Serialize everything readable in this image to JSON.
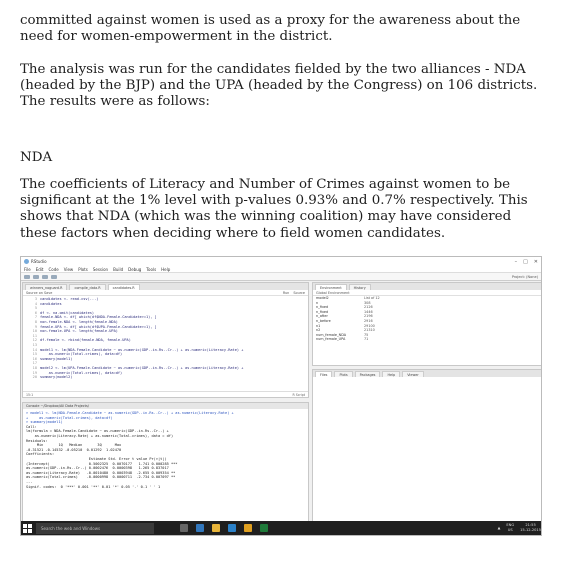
{
  "article": {
    "p1": "committed against women is used as a proxy for the awareness about the need for women-empowerment in the district.",
    "p2": "The analysis was run for the candidates fielded by the two alliances - NDA (headed by the BJP) and the UPA (headed by the Congress) on 106 districts. The results were as follows:",
    "heading": "NDA",
    "p3": "The coefficients of Literacy and Number of Crimes against women to be significant at the 1% level with p-values 0.93% and 0.7% respectively. This shows that NDA (which was the winning coalition) may have considered these factors when deciding where to field women candidates."
  },
  "rstudio": {
    "title": "RStudio",
    "menu": [
      "File",
      "Edit",
      "Code",
      "View",
      "Plots",
      "Session",
      "Build",
      "Debug",
      "Tools",
      "Help"
    ],
    "project": "Project: (None)",
    "editor_tabs": [
      "winners_noguard.R",
      "compile_data.R",
      "candidates.R"
    ],
    "editor_tool": "Source on Save",
    "run_label": "Run",
    "source_label": "Source",
    "code_lines": [
      [
        "3",
        "candidates <- read.csv(...)"
      ],
      [
        "4",
        "candidates"
      ],
      [
        "5",
        ""
      ],
      [
        "6",
        "df <- na.omit(candidates)"
      ],
      [
        "7",
        "female.NDA <- df[ which(df$NDA.Female.Candidate>=1), ]"
      ],
      [
        "8",
        "non.female.NDA <- length(female.NDA)"
      ],
      [
        "9",
        "female.UPA <- df[ which(df$UPA.Female.Candidate>=1), ]"
      ],
      [
        "10",
        "non.female.UPA <- length(female.UPA)"
      ],
      [
        "11",
        ""
      ],
      [
        "12",
        "df.female <- rbind(female.NDA, female.UPA)"
      ],
      [
        "13",
        ""
      ],
      [
        "14",
        "model1 <- lm(NDA.Female.Candidate ~ as.numeric(GDP..in.Rs..Cr..) + as.numeric(Literacy.Rate) +"
      ],
      [
        "15",
        "    as.numeric(Total.crimes), data=df)"
      ],
      [
        "16",
        "summary(model1)"
      ],
      [
        "17",
        ""
      ],
      [
        "18",
        "model2 <- lm(UPA.Female.Candidate ~ as.numeric(GDP..in.Rs..Cr..) + as.numeric(Literacy.Rate) +"
      ],
      [
        "19",
        "    as.numeric(Total.crimes), data=df)"
      ],
      [
        "20",
        "summary(model2)"
      ]
    ],
    "editor_status_left": "15:1",
    "editor_status_right": "R Script",
    "console_header": "Console  ~/Dropbox/All Data Projects/",
    "console_lines": [
      "> model1 <- lm(NDA.Female.Candidate ~ as.numeric(GDP..in.Rs..Cr..) + as.numeric(Literacy.Rate) +",
      "+     as.numeric(Total.crimes), data=df)",
      "> summary(model1)",
      "",
      "Call:",
      "lm(formula = NDA.Female.Candidate ~ as.numeric(GDP..in.Rs..Cr..) +",
      "    as.numeric(Literacy.Rate) + as.numeric(Total.crimes), data = df)",
      "",
      "Residuals:",
      "     Min       1Q   Median       3Q      Max",
      "-0.31521 -0.14532 -0.05210  0.01292  1.02470",
      "",
      "Coefficients:",
      "                             Estimate Std. Error t value Pr(>|t|)",
      "(Intercept)                  0.5002325  0.0070177   1.741 0.000285 ***",
      "as.numeric(GDP..in.Rs..Cr..) 0.0002476  0.0000398   1.265 0.837017",
      "as.numeric(Literacy.Rate)   -0.0010480  0.0003948  -2.655 0.009354 **",
      "as.numeric(Total.crimes)    -0.0000998  0.0000711  -2.734 0.007097 **",
      "---",
      "Signif. codes:  0 '***' 0.001 '**' 0.01 '*' 0.05 '.' 0.1 ' ' 1"
    ],
    "env_tabs": [
      "Environment",
      "History"
    ],
    "env_tool": "Global Environment",
    "env_rows": [
      [
        "model2",
        "List of 12"
      ],
      [
        "n",
        "308"
      ],
      [
        "n_fixed",
        "2126"
      ],
      [
        "n_fixed",
        "1446"
      ],
      [
        "n_after",
        "2196"
      ],
      [
        "n_before",
        "2916"
      ],
      [
        "n1",
        "29100"
      ],
      [
        "n2",
        "21310"
      ],
      [
        "num_female_NDA",
        "75"
      ],
      [
        "num_female_UPA",
        "71"
      ]
    ],
    "files_tabs": [
      "Files",
      "Plots",
      "Packages",
      "Help",
      "Viewer"
    ],
    "search_placeholder": "Search the web and Windows",
    "tray_lang": "ENG",
    "tray_region": "US",
    "clock_time": "21:55",
    "clock_date": "15-12-2015"
  },
  "colors": {
    "taskbar": "#1f1f1f",
    "link": "#2a52be"
  }
}
